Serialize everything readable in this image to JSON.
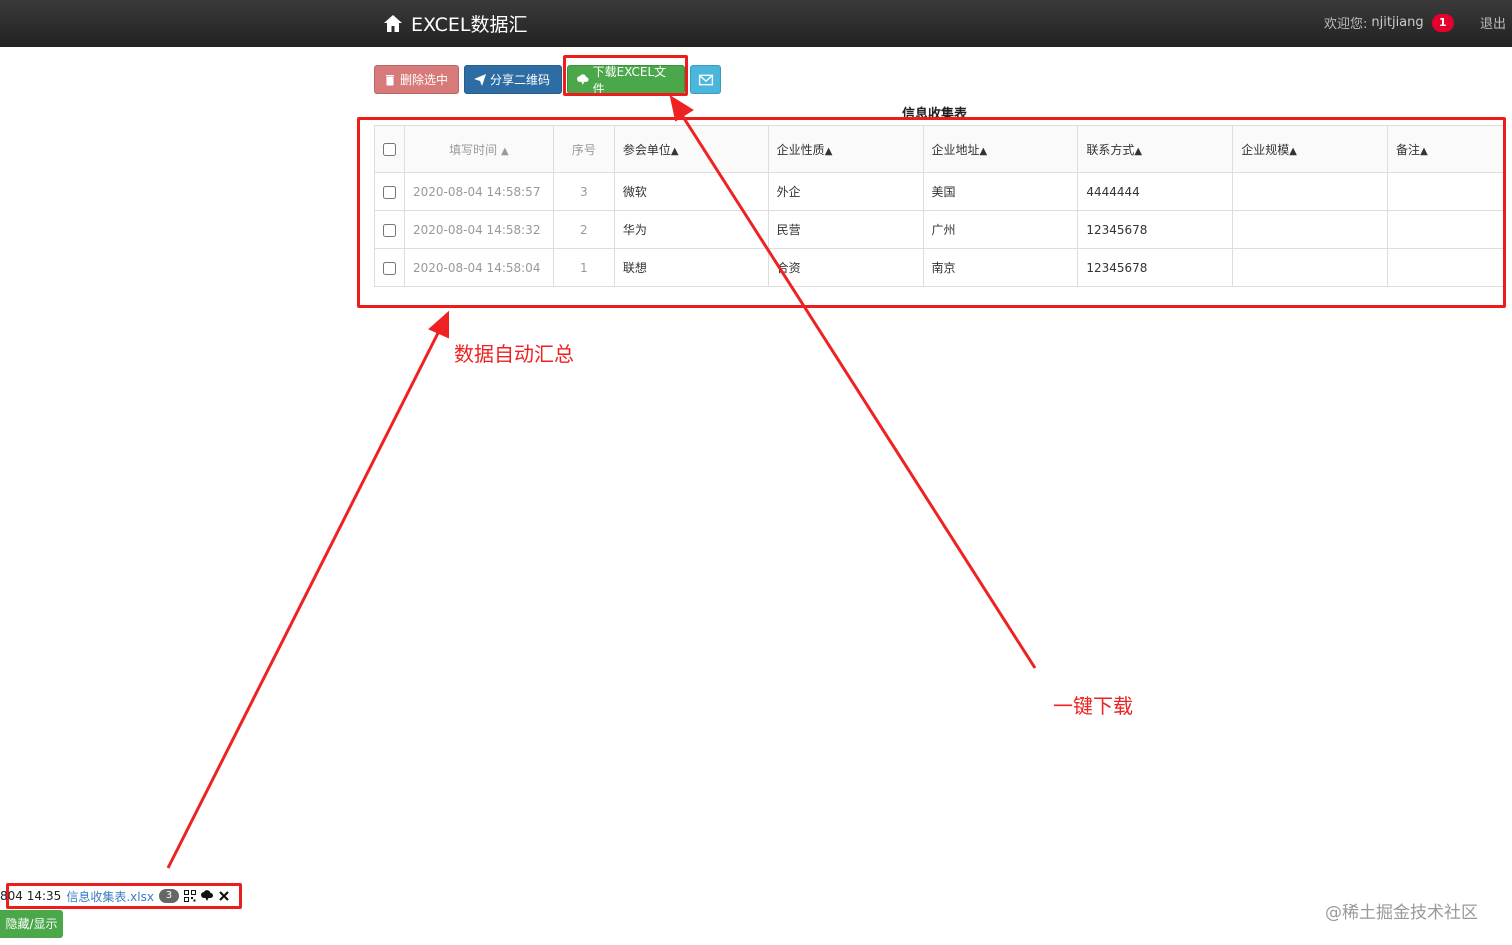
{
  "header": {
    "title": "EXCEL数据汇",
    "welcome_label": "欢迎您:",
    "username": "njitjiang",
    "notification_count": "1",
    "logout_label": "退出"
  },
  "toolbar": {
    "delete_label": "删除选中",
    "share_label": "分享二维码",
    "download_label": "下载EXCEL文件"
  },
  "table": {
    "title": "信息收集表",
    "columns": [
      "填写时间",
      "序号",
      "参会单位",
      "企业性质",
      "企业地址",
      "联系方式",
      "企业规模",
      "备注"
    ],
    "rows": [
      {
        "time": "2020-08-04 14:58:57",
        "no": "3",
        "unit": "微软",
        "nature": "外企",
        "address": "美国",
        "contact": "4444444",
        "scale": "",
        "remark": ""
      },
      {
        "time": "2020-08-04 14:58:32",
        "no": "2",
        "unit": "华为",
        "nature": "民营",
        "address": "广州",
        "contact": "12345678",
        "scale": "",
        "remark": ""
      },
      {
        "time": "2020-08-04 14:58:04",
        "no": "1",
        "unit": "联想",
        "nature": "合资",
        "address": "南京",
        "contact": "12345678",
        "scale": "",
        "remark": ""
      }
    ]
  },
  "annotations": {
    "summary_label": "数据自动汇总",
    "download_label": "一键下载"
  },
  "file_bar": {
    "time": "804 14:35",
    "file_name": "信息收集表.xlsx",
    "count": "3",
    "toggle_label": "隐藏/显示"
  },
  "watermark": "@稀土掘金技术社区",
  "colors": {
    "annotation_red": "#ee1d1d",
    "success_green": "#4aa84a",
    "primary_blue": "#2e6da4",
    "danger_red": "#d87a7a",
    "info_blue": "#4bb6dc"
  }
}
